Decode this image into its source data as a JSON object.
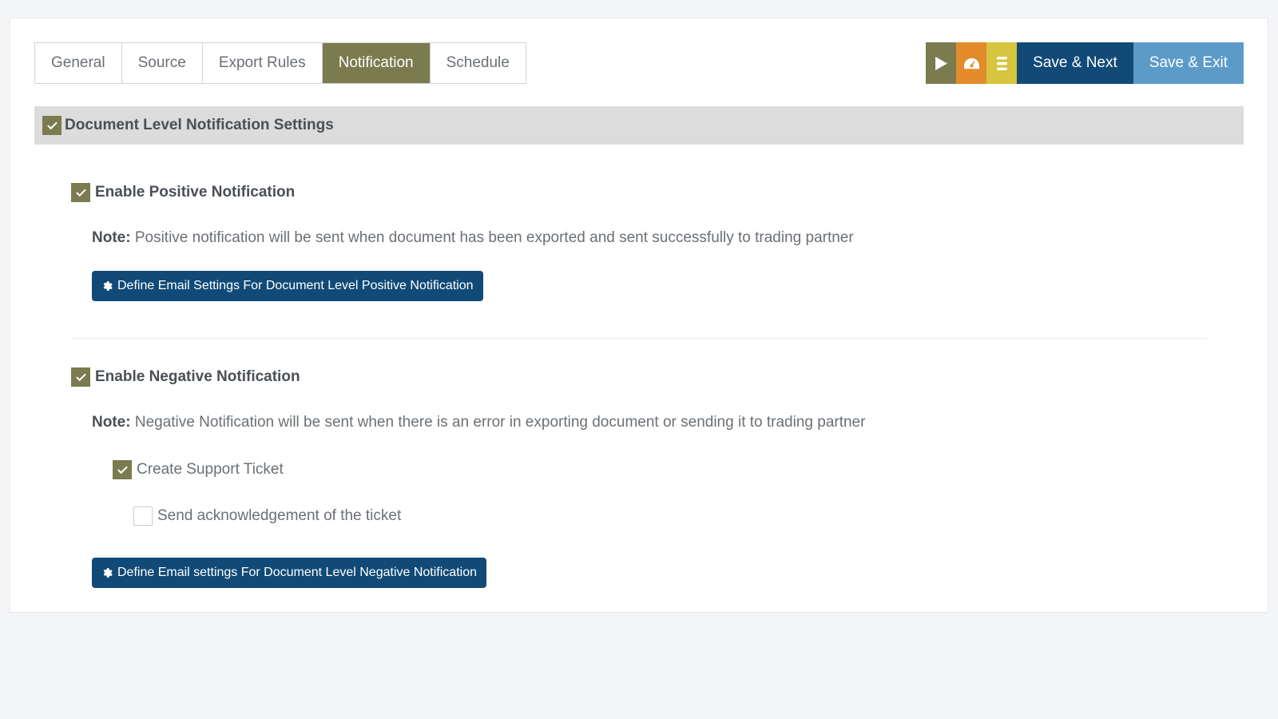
{
  "tabs": {
    "general": "General",
    "source": "Source",
    "export_rules": "Export Rules",
    "notification": "Notification",
    "schedule": "Schedule"
  },
  "actions": {
    "save_next": "Save & Next",
    "save_exit": "Save & Exit"
  },
  "section": {
    "header": "Document Level Notification Settings"
  },
  "positive": {
    "enable_label": "Enable Positive Notification",
    "note_prefix": "Note:",
    "note_text": " Positive notification will be sent when document has been exported and sent successfully to trading partner",
    "define_label": "Define Email Settings For Document Level Positive Notification"
  },
  "negative": {
    "enable_label": "Enable Negative Notification",
    "note_prefix": "Note:",
    "note_text": " Negative Notification will be sent when there is an error in exporting document or sending it to trading partner",
    "create_ticket_label": "Create Support Ticket",
    "send_ack_label": "Send acknowledgement of the ticket",
    "define_label": "Define Email settings For Document Level Negative Notification"
  }
}
